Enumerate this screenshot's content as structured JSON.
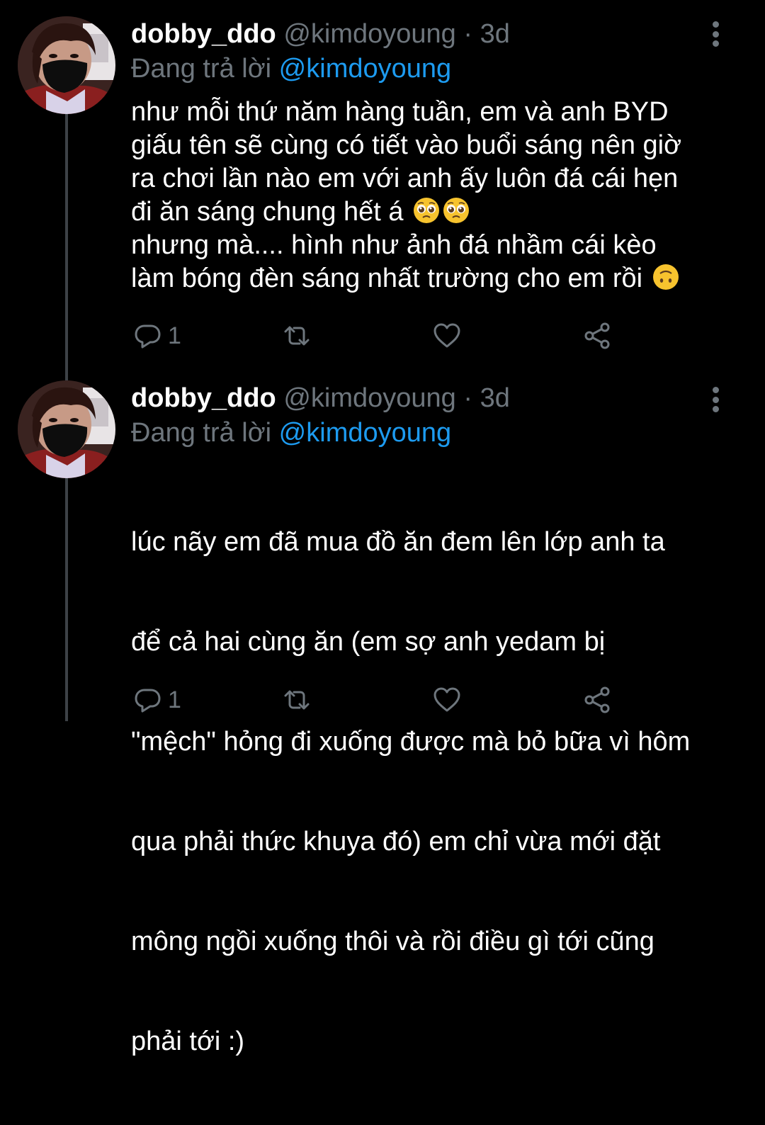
{
  "tweets": [
    {
      "display_name": "dobby_ddo",
      "handle": "@kimdoyoung",
      "separator": "·",
      "time": "3d",
      "reply_prefix": "Đang trả lời",
      "reply_to": "@kimdoyoung",
      "lines": [
        "như mỗi thứ năm hàng tuần, em và anh BYD",
        "giấu tên sẽ cùng có tiết vào buổi sáng nên giờ",
        "ra chơi lần nào em với anh ấy luôn đá cái hẹn",
        "đi ăn sáng chung hết á",
        "nhưng mà.... hình như ảnh đá nhầm cái kèo",
        "làm bóng đèn sáng nhất trường cho em rồi"
      ],
      "emojis": [
        "pleading-face-emoji",
        "pleading-face-emoji",
        "upside-down-face-emoji"
      ],
      "reply_count": "1",
      "icons": {
        "reply": "reply-icon",
        "retweet": "retweet-icon",
        "like": "heart-icon",
        "share": "share-icon",
        "more": "more-icon"
      }
    },
    {
      "display_name": "dobby_ddo",
      "handle": "@kimdoyoung",
      "separator": "·",
      "time": "3d",
      "reply_prefix": "Đang trả lời",
      "reply_to": "@kimdoyoung",
      "lines": [
        "  lúc nãy em đã mua đồ ăn đem lên lớp anh ta",
        "để cả hai cùng ăn (em sợ anh yedam bị",
        "\"mệch\" hỏng đi xuống được mà bỏ bữa vì hôm",
        "qua phải thức khuya đó) em chỉ vừa mới đặt",
        "mông ngồi xuống thôi và rồi điều gì tới cũng",
        "phải tới :)"
      ],
      "reply_count": "1",
      "icons": {
        "reply": "reply-icon",
        "retweet": "retweet-icon",
        "like": "heart-icon",
        "share": "share-icon",
        "more": "more-icon"
      }
    }
  ],
  "colors": {
    "background": "#000000",
    "text": "#ffffff",
    "muted": "#6e767d",
    "mention": "#1d9bf0",
    "thread_line": "#3d4247"
  }
}
